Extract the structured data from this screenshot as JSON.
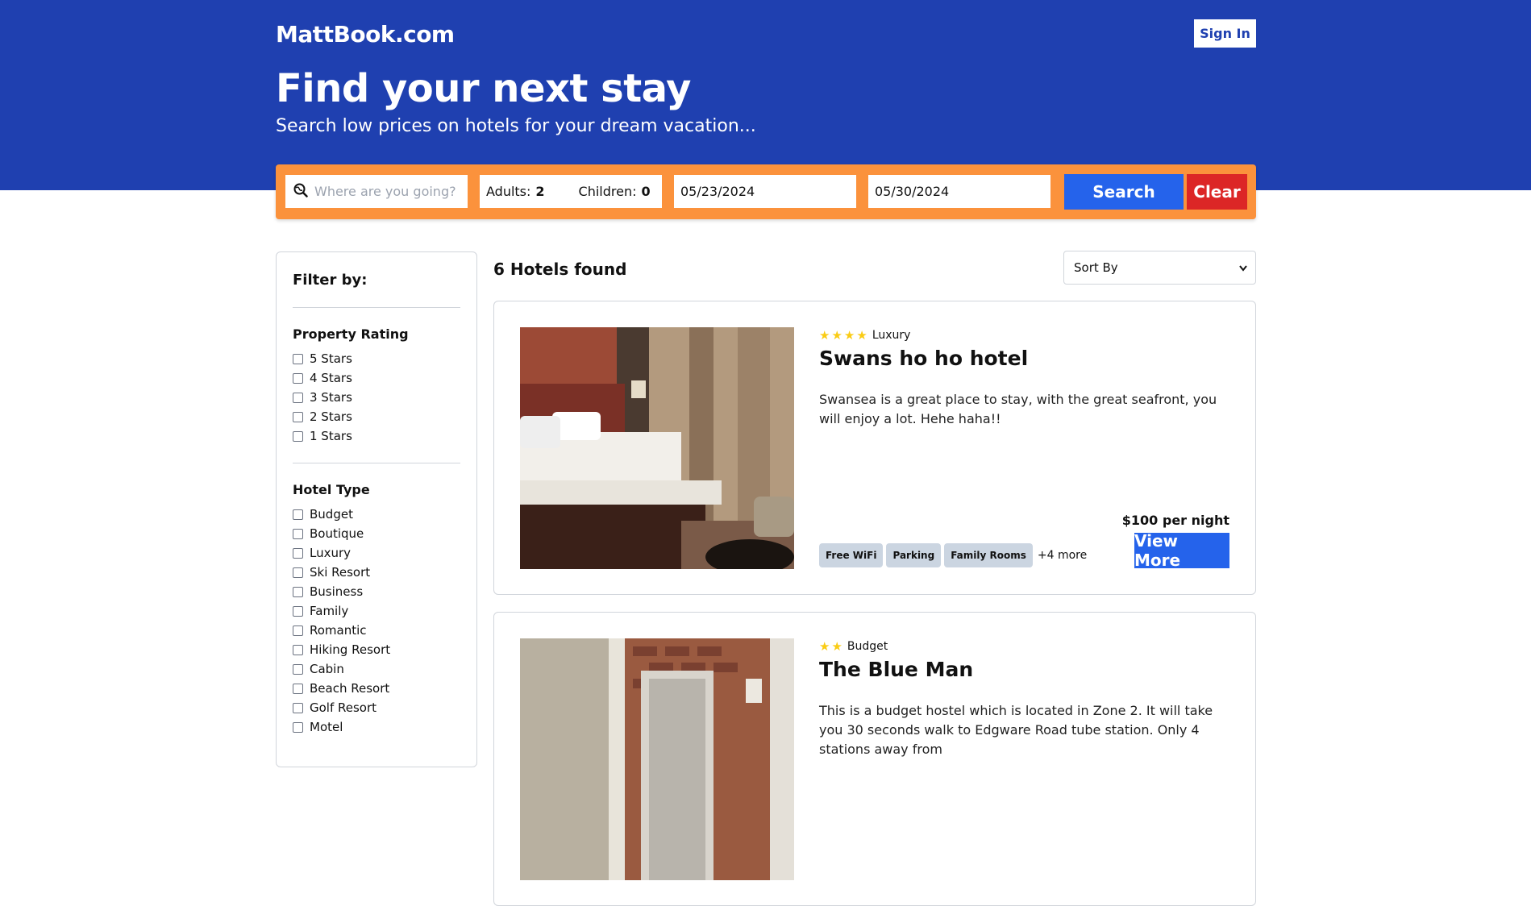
{
  "header": {
    "logo": "MattBook.com",
    "signin_label": "Sign In",
    "title": "Find your next stay",
    "subtitle": "Search low prices on hotels for your dream vacation..."
  },
  "search": {
    "destination_placeholder": "Where are you going?",
    "adults_label": "Adults:",
    "adults_value": "2",
    "children_label": "Children:",
    "children_value": "0",
    "checkin": "05/23/2024",
    "checkout": "05/30/2024",
    "search_label": "Search",
    "clear_label": "Clear",
    "colors": {
      "bar": "#fb923c",
      "search": "#2563eb",
      "clear": "#dc2626"
    }
  },
  "filters": {
    "title": "Filter by:",
    "rating": {
      "title": "Property Rating",
      "options": [
        "5 Stars",
        "4 Stars",
        "3 Stars",
        "2 Stars",
        "1 Stars"
      ]
    },
    "type": {
      "title": "Hotel Type",
      "options": [
        "Budget",
        "Boutique",
        "Luxury",
        "Ski Resort",
        "Business",
        "Family",
        "Romantic",
        "Hiking Resort",
        "Cabin",
        "Beach Resort",
        "Golf Resort",
        "Motel"
      ]
    }
  },
  "results": {
    "count_label": "6 Hotels found",
    "sort_label": "Sort By",
    "hotels": [
      {
        "star_count": 4,
        "type": "Luxury",
        "name": "Swans ho ho hotel",
        "description": "Swansea is a great place to stay, with the great seafront, you will enjoy a lot. Hehe haha!!",
        "facilities": [
          "Free WiFi",
          "Parking",
          "Family Rooms"
        ],
        "more_label": "+4 more",
        "price": "$100 per night",
        "view_label": "View More"
      },
      {
        "star_count": 2,
        "type": "Budget",
        "name": "The Blue Man",
        "description": "This is a budget hostel which is located in Zone 2. It will take you 30 seconds walk to Edgware Road tube station. Only 4 stations away from"
      }
    ]
  }
}
